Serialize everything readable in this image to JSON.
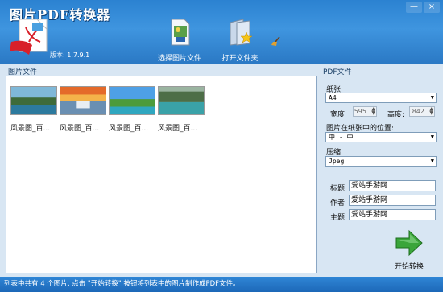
{
  "app": {
    "title": "图片PDF转换器",
    "version": "版本: 1.7.9.1",
    "controls": {
      "minimize": "—",
      "close": "×"
    }
  },
  "toolbar": {
    "select_images": "选择图片文件",
    "open_folder": "打开文件夹"
  },
  "left": {
    "title": "图片文件",
    "thumbnails": [
      {
        "name": "风景图_百..."
      },
      {
        "name": "风景图_百..."
      },
      {
        "name": "风景图_百..."
      },
      {
        "name": "风景图_百..."
      }
    ]
  },
  "right": {
    "title": "PDF文件",
    "paper_label": "纸张:",
    "paper_value": "A4",
    "width_label": "宽度:",
    "width_value": "595",
    "height_label": "高度:",
    "height_value": "842",
    "position_label": "图片在纸张中的位置:",
    "position_value": "中 - 中",
    "compress_label": "压缩:",
    "compress_value": "Jpeg",
    "title_label": "标题:",
    "title_value": "爱站手游网",
    "author_label": "作者:",
    "author_value": "爱站手游网",
    "subject_label": "主题:",
    "subject_value": "爱站手游网",
    "start_label": "开始转换"
  },
  "status": {
    "text": "列表中共有 4 个图片, 点击 \"开始转换\" 按钮将列表中的图片制作成PDF文件。"
  },
  "colors": {
    "header_blue": "#2b82d1",
    "panel_bg": "#d8e6f3",
    "start_green": "#3aa53a"
  },
  "icons": {
    "logo": "pdf-document-icon",
    "select": "image-file-icon",
    "open": "folder-star-icon",
    "clear": "broom-icon",
    "start": "right-arrow-icon"
  }
}
